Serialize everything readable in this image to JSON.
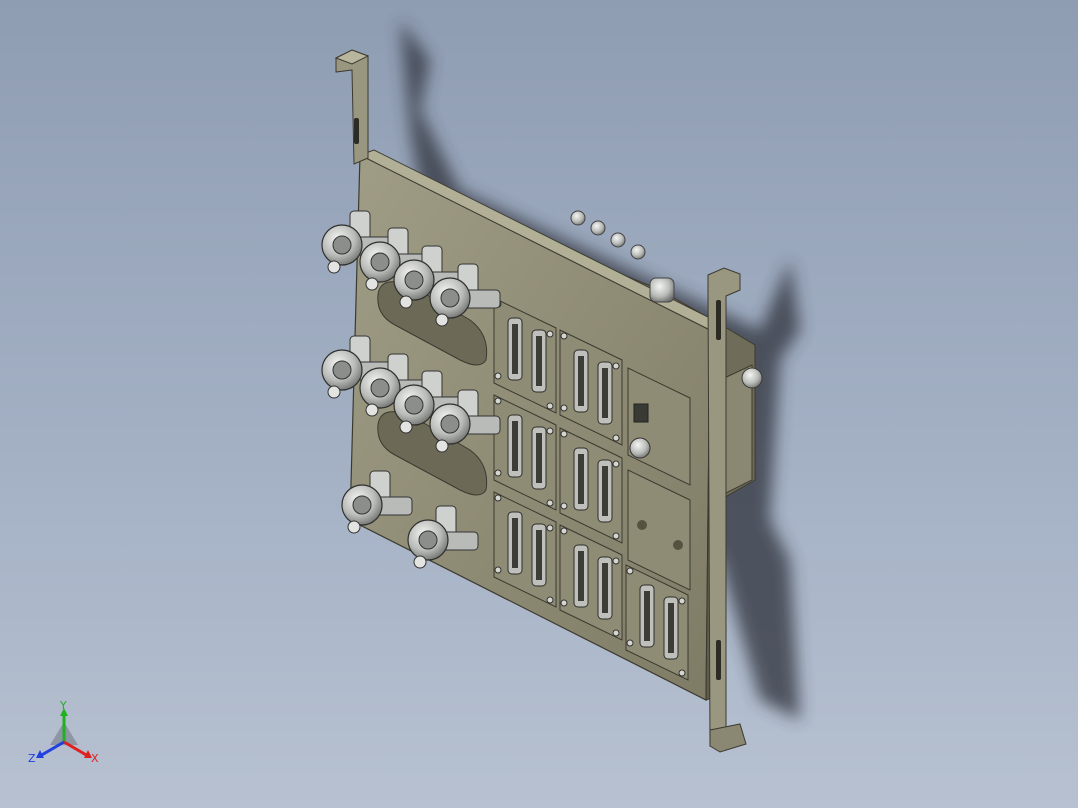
{
  "viewport": {
    "background_top": "#8f9db3",
    "background_bottom": "#b7c1d1"
  },
  "model": {
    "plate_color": "#8d8a72",
    "plate_edge_color": "#3c3a30",
    "bracket_color": "#9a9781",
    "shadow_color": "#2f333b",
    "valve_metal_color": "#c9cbc8",
    "valve_count": 10,
    "connector_module_count": 9,
    "connector_icon": "d-sub-connector-icon",
    "valve_icon": "pneumatic-valve-icon"
  },
  "triad": {
    "x_label": "X",
    "y_label": "Y",
    "z_label": "Z",
    "x_color": "#e02020",
    "y_color": "#20b020",
    "z_color": "#2040e0"
  }
}
